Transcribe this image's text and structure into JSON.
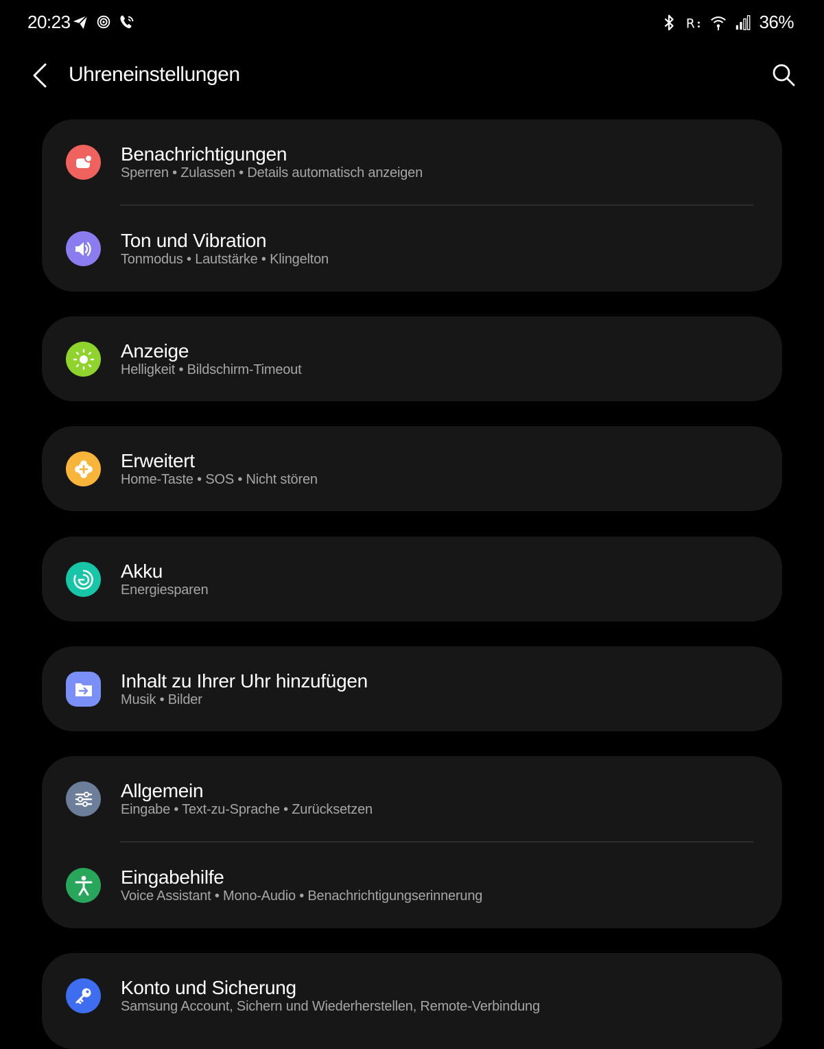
{
  "status_bar": {
    "time": "20:23",
    "left_icons": [
      "send-icon",
      "target-icon",
      "wifi-call-icon"
    ],
    "right_icons": [
      "bluetooth-icon",
      "network-r-icon",
      "wifi-icon",
      "signal-icon"
    ],
    "battery": "36%"
  },
  "header": {
    "title": "Uhreneinstellungen",
    "back_icon": "chevron-left-icon",
    "search_icon": "search-icon"
  },
  "colors": {
    "background": "#000000",
    "card": "#171717",
    "notifications": "#f0625d",
    "sound": "#8b7cf0",
    "display": "#8fd42c",
    "advanced": "#f9b43a",
    "battery": "#17c5a7",
    "content": "#7a8ff7",
    "general": "#6c7e9a",
    "accessibility": "#27a65c",
    "account": "#3f6df0"
  },
  "items": [
    {
      "title": "Benachrichtigungen",
      "subtitle": "Sperren • Zulassen • Details automatisch anzeigen",
      "icon": "notification-icon"
    },
    {
      "title": "Ton und Vibration",
      "subtitle": "Tonmodus • Lautstärke • Klingelton",
      "icon": "speaker-icon"
    },
    {
      "title": "Anzeige",
      "subtitle": "Helligkeit • Bildschirm-Timeout",
      "icon": "brightness-icon"
    },
    {
      "title": "Erweitert",
      "subtitle": "Home-Taste • SOS • Nicht stören",
      "icon": "plus-gear-icon"
    },
    {
      "title": "Akku",
      "subtitle": "Energiesparen",
      "icon": "battery-care-icon"
    },
    {
      "title": "Inhalt zu Ihrer Uhr hinzufügen",
      "subtitle": "Musik • Bilder",
      "icon": "folder-transfer-icon"
    },
    {
      "title": "Allgemein",
      "subtitle": "Eingabe • Text-zu-Sprache • Zurücksetzen",
      "icon": "sliders-icon"
    },
    {
      "title": "Eingabehilfe",
      "subtitle": "Voice Assistant • Mono-Audio • Benachrichtigungserinnerung",
      "icon": "accessibility-icon"
    },
    {
      "title": "Konto und Sicherung",
      "subtitle": "Samsung Account, Sichern und Wiederherstellen, Remote-Verbindung",
      "icon": "key-icon"
    }
  ]
}
